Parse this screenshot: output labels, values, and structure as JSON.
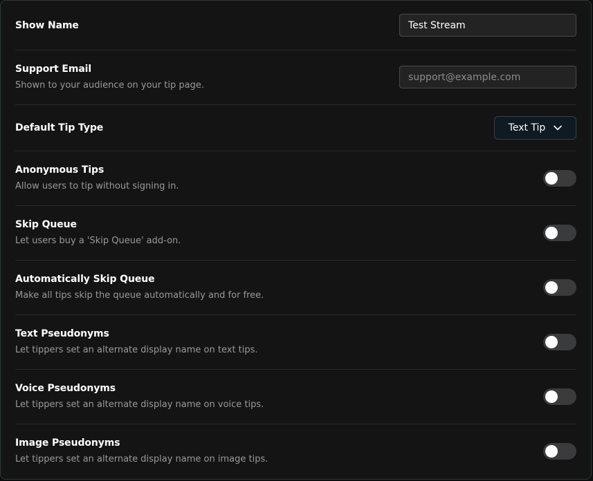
{
  "settings": {
    "show_name": {
      "label": "Show Name",
      "value": "Test Stream"
    },
    "support_email": {
      "label": "Support Email",
      "description": "Shown to your audience on your tip page.",
      "placeholder": "support@example.com",
      "value": ""
    },
    "default_tip_type": {
      "label": "Default Tip Type",
      "selected": "Text Tip"
    },
    "anonymous_tips": {
      "label": "Anonymous Tips",
      "description": "Allow users to tip without signing in.",
      "enabled": false
    },
    "skip_queue": {
      "label": "Skip Queue",
      "description": "Let users buy a 'Skip Queue' add-on.",
      "enabled": false
    },
    "auto_skip_queue": {
      "label": "Automatically Skip Queue",
      "description": "Make all tips skip the queue automatically and for free.",
      "enabled": false
    },
    "text_pseudonyms": {
      "label": "Text Pseudonyms",
      "description": "Let tippers set an alternate display name on text tips.",
      "enabled": false
    },
    "voice_pseudonyms": {
      "label": "Voice Pseudonyms",
      "description": "Let tippers set an alternate display name on voice tips.",
      "enabled": false
    },
    "image_pseudonyms": {
      "label": "Image Pseudonyms",
      "description": "Let tippers set an alternate display name on image tips.",
      "enabled": false
    }
  },
  "icons": {
    "select_chevron": "chevron-down-icon"
  },
  "colors": {
    "panel_background": "#141414",
    "panel_border": "#2b3a40",
    "row_divider": "#2a2a2a",
    "toggle_off": "#3a3b3d",
    "description_text": "#9a9a9a"
  }
}
